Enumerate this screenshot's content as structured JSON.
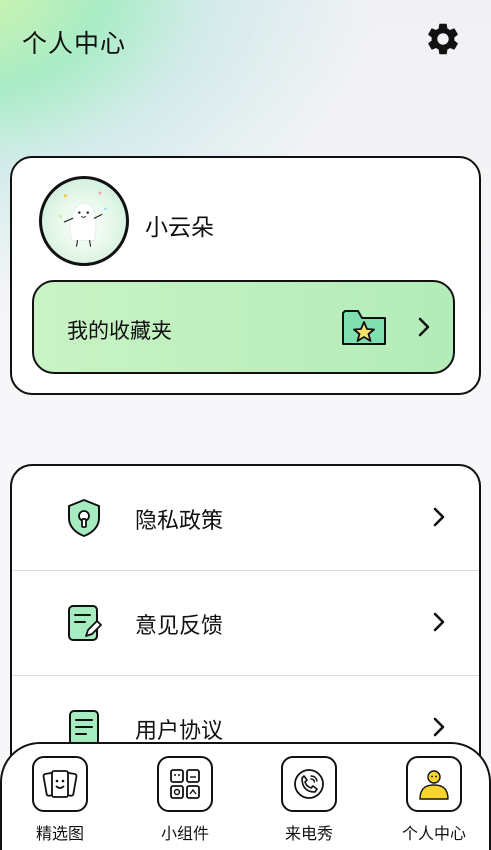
{
  "header": {
    "title": "个人中心"
  },
  "profile": {
    "username": "小云朵"
  },
  "favorites": {
    "label": "我的收藏夹"
  },
  "menu": {
    "items": [
      {
        "label": "隐私政策",
        "icon": "shield-keyhole-icon"
      },
      {
        "label": "意见反馈",
        "icon": "feedback-edit-icon"
      },
      {
        "label": "用户协议",
        "icon": "document-lines-icon"
      }
    ]
  },
  "tabbar": {
    "tabs": [
      {
        "label": "精选图",
        "icon": "photo-cards-icon",
        "active": false
      },
      {
        "label": "小组件",
        "icon": "widgets-grid-icon",
        "active": false
      },
      {
        "label": "来电秀",
        "icon": "phone-call-icon",
        "active": false
      },
      {
        "label": "个人中心",
        "icon": "profile-person-icon",
        "active": true
      }
    ]
  },
  "colors": {
    "accent_green": "#b3ecb8",
    "icon_green": "#a6ecc0",
    "profile_yellow": "#f8d52c",
    "outline": "#111111"
  }
}
